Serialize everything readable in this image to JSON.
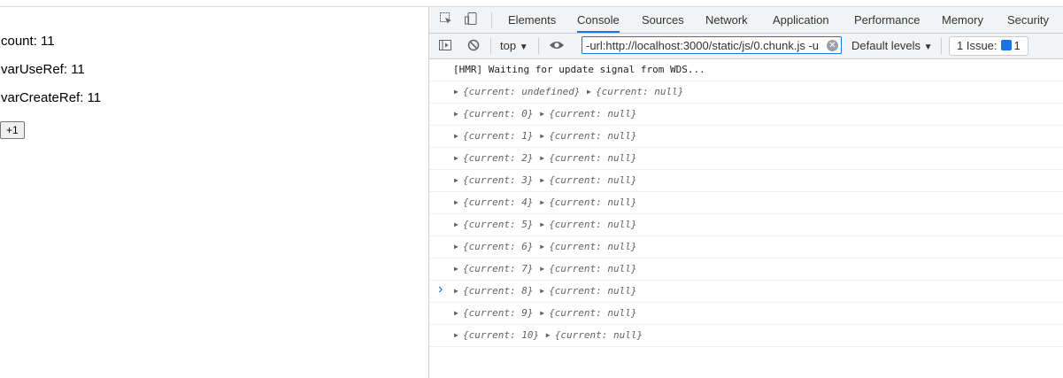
{
  "page": {
    "count_line": "count: 11",
    "use_ref_line": "varUseRef: 11",
    "create_ref_line": "varCreateRef: 11",
    "increment_button": "+1"
  },
  "devtools": {
    "tabs": [
      "Elements",
      "Console",
      "Sources",
      "Network",
      "Application",
      "Performance",
      "Memory",
      "Security"
    ],
    "active_tab": "Console",
    "context": "top",
    "filter_value": "-url:http://localhost:3000/static/js/0.chunk.js -u",
    "levels": "Default levels",
    "issues_label": "1 Issue:",
    "issues_count": "1"
  },
  "console": {
    "hmr_message": "[HMR] Waiting for update signal from WDS...",
    "rows": [
      {
        "left": "{current: undefined}",
        "right": "{current: null}"
      },
      {
        "left": "{current: 0}",
        "right": "{current: null}"
      },
      {
        "left": "{current: 1}",
        "right": "{current: null}"
      },
      {
        "left": "{current: 2}",
        "right": "{current: null}"
      },
      {
        "left": "{current: 3}",
        "right": "{current: null}"
      },
      {
        "left": "{current: 4}",
        "right": "{current: null}"
      },
      {
        "left": "{current: 5}",
        "right": "{current: null}"
      },
      {
        "left": "{current: 6}",
        "right": "{current: null}"
      },
      {
        "left": "{current: 7}",
        "right": "{current: null}"
      },
      {
        "left": "{current: 8}",
        "right": "{current: null}"
      },
      {
        "left": "{current: 9}",
        "right": "{current: null}"
      },
      {
        "left": "{current: 10}",
        "right": "{current: null}"
      }
    ],
    "prompt": "›"
  }
}
